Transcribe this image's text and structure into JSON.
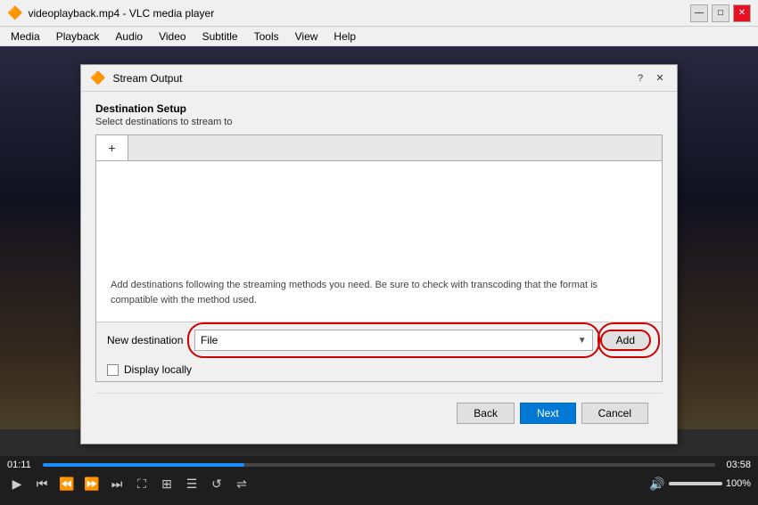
{
  "window": {
    "title": "videoplayback.mp4 - VLC media player",
    "icon": "🔶"
  },
  "titlebar": {
    "minimize": "—",
    "maximize": "□",
    "close": "✕"
  },
  "menu": {
    "items": [
      "Media",
      "Playback",
      "Audio",
      "Video",
      "Subtitle",
      "Tools",
      "View",
      "Help"
    ]
  },
  "dialog": {
    "title": "Stream Output",
    "help_icon": "?",
    "close_icon": "✕",
    "header": {
      "title": "Destination Setup",
      "subtitle": "Select destinations to stream to"
    },
    "add_tab_icon": "+",
    "content_info": "Add destinations following the streaming methods you need. Be sure to check with transcoding that the format is compatible with the method used.",
    "new_destination_label": "New destination",
    "dropdown_value": "File",
    "dropdown_arrow": "▼",
    "add_button_label": "Add",
    "display_locally_label": "Display locally",
    "footer": {
      "back_label": "Back",
      "next_label": "Next",
      "cancel_label": "Cancel"
    }
  },
  "controls": {
    "time_left": "01:11",
    "time_right": "03:58",
    "progress_pct": 30,
    "volume_pct": "100%",
    "volume_fill_pct": 100,
    "play_icon": "▶",
    "prev_icon": "⏮",
    "prev_frame_icon": "⏪",
    "next_frame_icon": "⏩",
    "next_icon": "⏭",
    "fullscreen_icon": "⛶",
    "extended_icon": "⊞",
    "playlist_icon": "☰",
    "loop_icon": "↺",
    "random_icon": "⇄",
    "shuffle_icon": "⇌",
    "volume_icon": "🔊"
  }
}
